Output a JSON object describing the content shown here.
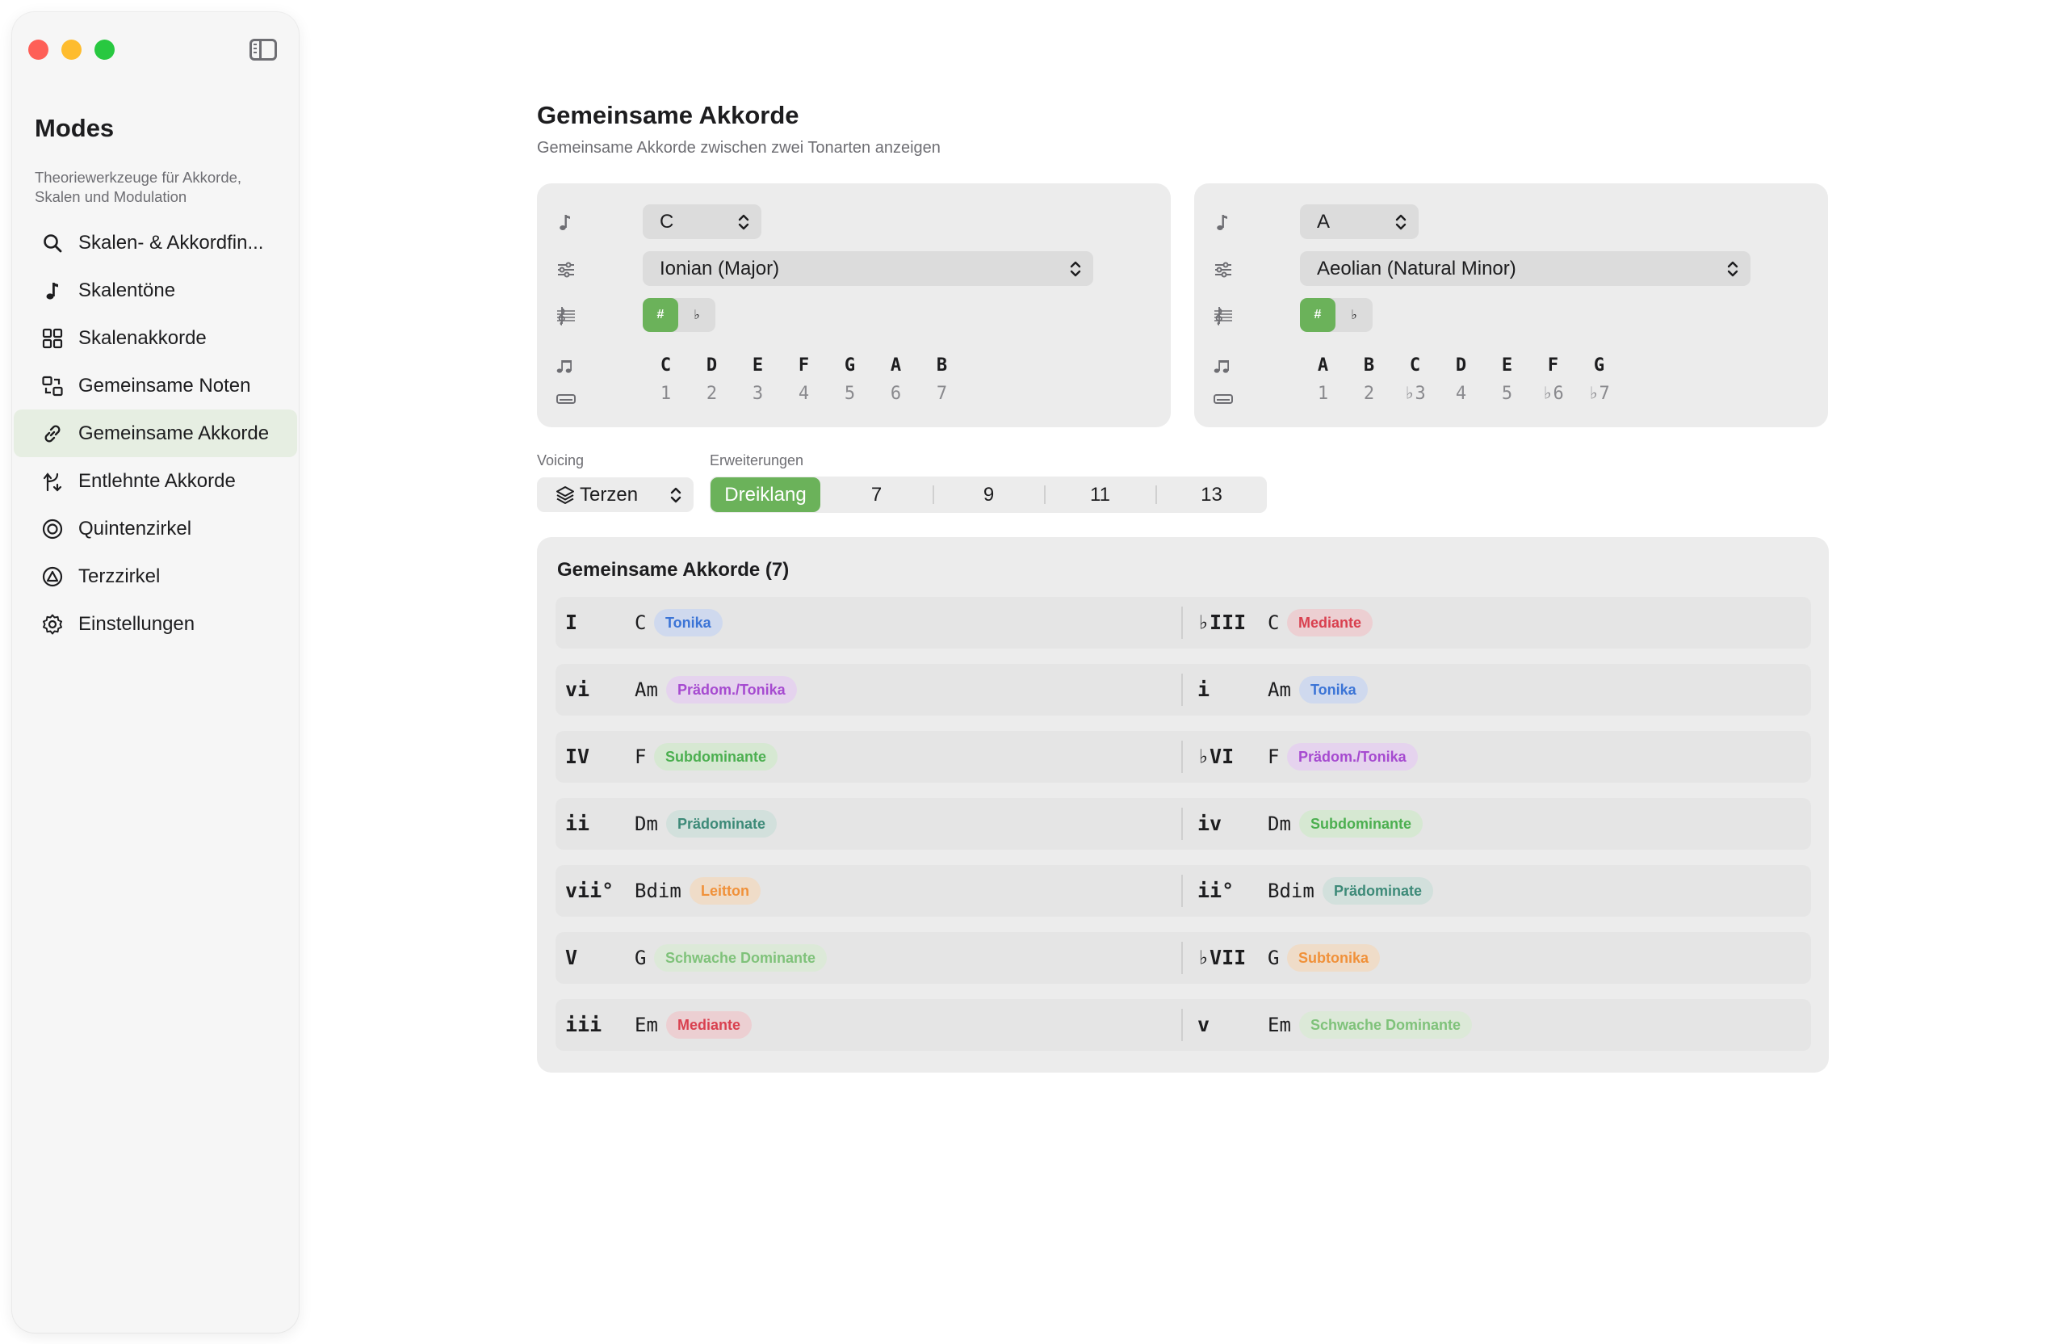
{
  "sidebar": {
    "title": "Modes",
    "subtitle": "Theoriewerkzeuge für Akkorde, Skalen und Modulation",
    "items": [
      {
        "label": "Skalen- & Akkordfin...",
        "icon": "magnifier-icon"
      },
      {
        "label": "Skalentöne",
        "icon": "music-note-icon"
      },
      {
        "label": "Skalenakkorde",
        "icon": "grid-icon"
      },
      {
        "label": "Gemeinsame Noten",
        "icon": "swap-squares-icon"
      },
      {
        "label": "Gemeinsame Akkorde",
        "icon": "link-icon",
        "active": true
      },
      {
        "label": "Entlehnte Akkorde",
        "icon": "branch-arrows-icon"
      },
      {
        "label": "Quintenzirkel",
        "icon": "target-circle-icon"
      },
      {
        "label": "Terzzirkel",
        "icon": "triangle-circle-icon"
      },
      {
        "label": "Einstellungen",
        "icon": "gear-icon"
      }
    ]
  },
  "header": {
    "title": "Gemeinsame Akkorde",
    "subtitle": "Gemeinsame Akkorde zwischen zwei Tonarten anzeigen"
  },
  "key_left": {
    "root": "C",
    "mode": "Ionian (Major)",
    "sharp": "#",
    "flat": "♭",
    "notes": [
      "C",
      "D",
      "E",
      "F",
      "G",
      "A",
      "B"
    ],
    "degrees": [
      "1",
      "2",
      "3",
      "4",
      "5",
      "6",
      "7"
    ]
  },
  "key_right": {
    "root": "A",
    "mode": "Aeolian (Natural Minor)",
    "sharp": "#",
    "flat": "♭",
    "notes": [
      "A",
      "B",
      "C",
      "D",
      "E",
      "F",
      "G"
    ],
    "degrees": [
      "1",
      "2",
      "♭3",
      "4",
      "5",
      "♭6",
      "♭7"
    ]
  },
  "controls": {
    "voicing_label": "Voicing",
    "voicing_value": "Terzen",
    "extensions_label": "Erweiterungen",
    "extensions": [
      "Dreiklang",
      "7",
      "9",
      "11",
      "13"
    ],
    "active_extension": 0
  },
  "common_chords": {
    "title": "Gemeinsame Akkorde (7)",
    "rows": [
      {
        "l_roman": "I",
        "l_chord": "C",
        "l_func": "Tonika",
        "l_color": "blue",
        "r_roman": "♭III",
        "r_chord": "C",
        "r_func": "Mediante",
        "r_color": "red"
      },
      {
        "l_roman": "vi",
        "l_chord": "Am",
        "l_func": "Prädom./Tonika",
        "l_color": "purple",
        "r_roman": "i",
        "r_chord": "Am",
        "r_func": "Tonika",
        "r_color": "blue"
      },
      {
        "l_roman": "IV",
        "l_chord": "F",
        "l_func": "Subdominante",
        "l_color": "green",
        "r_roman": "♭VI",
        "r_chord": "F",
        "r_func": "Prädom./Tonika",
        "r_color": "purple"
      },
      {
        "l_roman": "ii",
        "l_chord": "Dm",
        "l_func": "Prädominate",
        "l_color": "teal",
        "r_roman": "iv",
        "r_chord": "Dm",
        "r_func": "Subdominante",
        "r_color": "green"
      },
      {
        "l_roman": "vii°",
        "l_chord": "Bdim",
        "l_func": "Leitton",
        "l_color": "orange",
        "r_roman": "ii°",
        "r_chord": "Bdim",
        "r_func": "Prädominate",
        "r_color": "teal"
      },
      {
        "l_roman": "V",
        "l_chord": "G",
        "l_func": "Schwache Dominante",
        "l_color": "lightgreen",
        "r_roman": "♭VII",
        "r_chord": "G",
        "r_func": "Subtonika",
        "r_color": "orange"
      },
      {
        "l_roman": "iii",
        "l_chord": "Em",
        "l_func": "Mediante",
        "l_color": "red",
        "r_roman": "v",
        "r_chord": "Em",
        "r_func": "Schwache Dominante",
        "r_color": "lightgreen"
      }
    ]
  },
  "colors": {
    "accent": "#6bb25a",
    "badges": {
      "blue": {
        "bg": "#cfd9ee",
        "fg": "#3b74d6"
      },
      "red": {
        "bg": "#eccfd2",
        "fg": "#d9404f"
      },
      "purple": {
        "bg": "#e5d3ee",
        "fg": "#a64ad0"
      },
      "green": {
        "bg": "#d6e8d2",
        "fg": "#4caf50"
      },
      "teal": {
        "bg": "#d2e0dc",
        "fg": "#3d8a78"
      },
      "orange": {
        "bg": "#efdcc8",
        "fg": "#f0913a"
      },
      "lightgreen": {
        "bg": "#dce9d8",
        "fg": "#7fc27a"
      }
    }
  }
}
